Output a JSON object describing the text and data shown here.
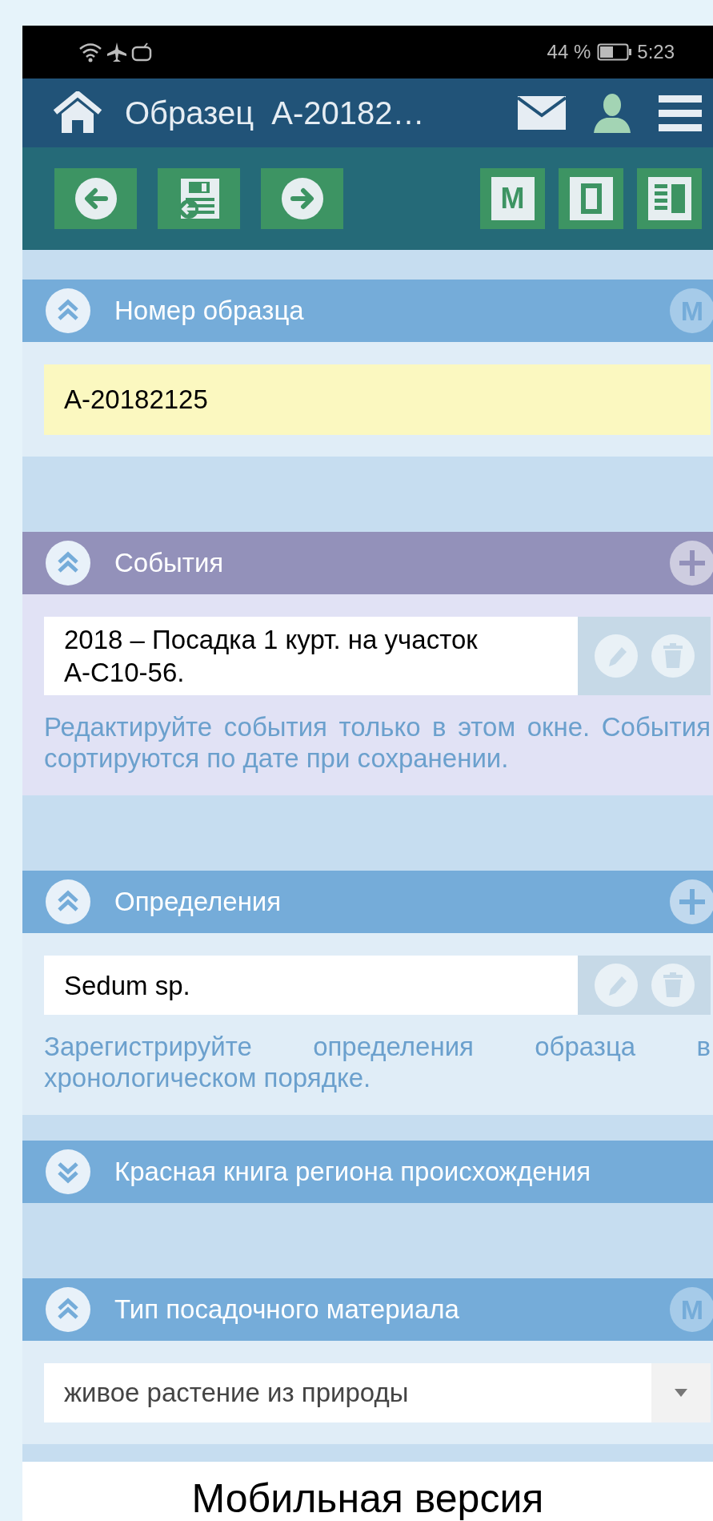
{
  "status_bar": {
    "battery_text": "44 %",
    "time": "5:23"
  },
  "header": {
    "title": "Образец  А-20182…"
  },
  "toolbar": {
    "buttons": [
      {
        "kind": "back"
      },
      {
        "kind": "save"
      },
      {
        "kind": "forward"
      },
      {
        "kind": "letter",
        "label": "M"
      },
      {
        "kind": "single"
      },
      {
        "kind": "columns"
      }
    ]
  },
  "sections": [
    {
      "title": "Номер образца",
      "expanded": true,
      "color": "#75acd9",
      "corner": {
        "kind": "badge",
        "label": "M"
      },
      "kind": "field",
      "value": "А-20182125"
    },
    {
      "title": "События",
      "expanded": true,
      "color": "#9391ba",
      "corner": {
        "kind": "add"
      },
      "kind": "list",
      "items": [
        "2018 – Посадка 1 курт. на участок А-С10-56."
      ],
      "hint": "Редактируйте события только в этом окне. События сортируются по дате при сохранении."
    },
    {
      "title": "Определения",
      "expanded": true,
      "color": "#75acd9",
      "corner": {
        "kind": "add"
      },
      "kind": "list",
      "items": [
        "Sedum sp."
      ],
      "hint": "Зарегистрируйте определения образца в хронологическом порядке."
    },
    {
      "title": "Красная книга региона происхождения",
      "expanded": false,
      "color": "#75acd9"
    },
    {
      "title": "Тип посадочного материала",
      "expanded": true,
      "color": "#75acd9",
      "corner": {
        "kind": "badge",
        "label": "M"
      },
      "kind": "select",
      "value": "живое растение из природы"
    }
  ],
  "caption": "Мобильная версия"
}
